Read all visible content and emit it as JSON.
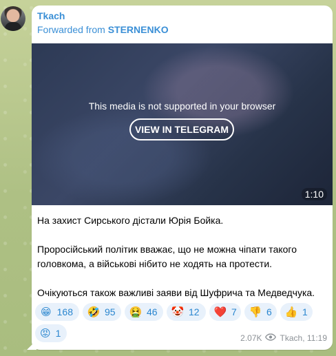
{
  "message": {
    "sender": "Tkach",
    "forwarded_prefix": "Forwarded from ",
    "forwarded_source": "STERNENKO",
    "media": {
      "unsupported_text": "This media is not supported in your browser",
      "view_button": "VIEW IN TELEGRAM",
      "duration": "1:10"
    },
    "text": [
      "На захист Сирського дістали Юрія Бойка.",
      "Проросійський політик вважає, що не можна чіпати такого головкома, а військові нібито не ходять на протести.",
      "Очікуються також важливі заяви від Шуфрича та Медведчука."
    ],
    "reactions": [
      {
        "emoji": "😁",
        "count": "168"
      },
      {
        "emoji": "🤣",
        "count": "95"
      },
      {
        "emoji": "🤮",
        "count": "46"
      },
      {
        "emoji": "🤡",
        "count": "12"
      },
      {
        "emoji": "❤️",
        "count": "7"
      },
      {
        "emoji": "👎",
        "count": "6"
      },
      {
        "emoji": "👍",
        "count": "1"
      },
      {
        "emoji": "😡",
        "count": "1"
      }
    ],
    "views": "2.07K",
    "signature_time": "Tkach, 11:19"
  },
  "icons": {
    "avatar": "avatar-photo",
    "views": "eye-icon"
  },
  "colors": {
    "accent": "#3a8fd6",
    "reaction_bg": "#e8f1fb",
    "bubble": "#ffffff",
    "meta": "#8c9196"
  }
}
